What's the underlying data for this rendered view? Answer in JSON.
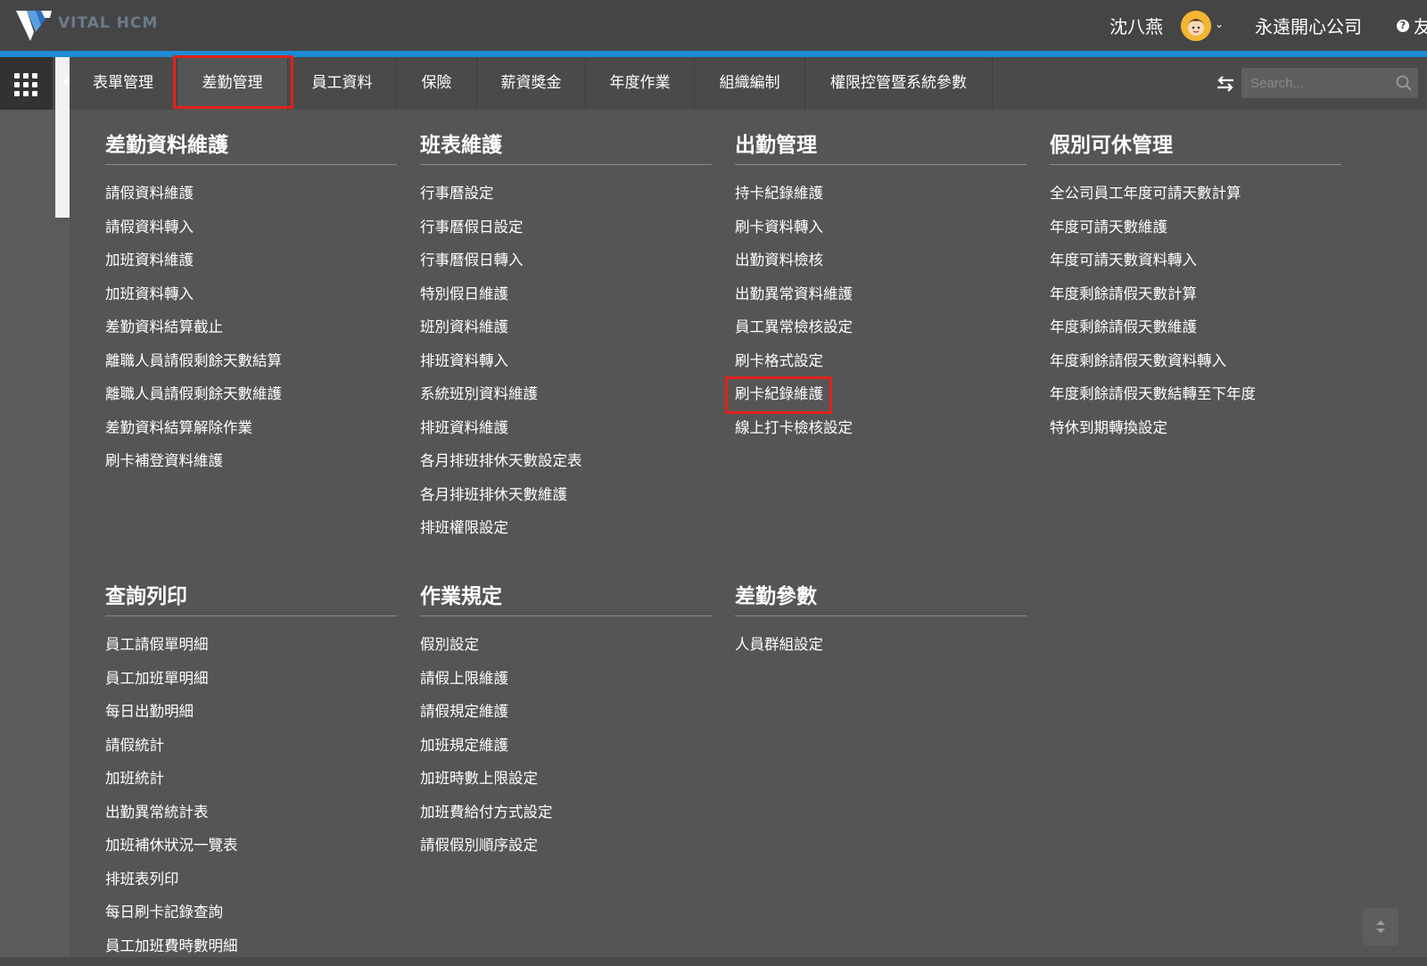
{
  "header": {
    "logo_text": "VITAL HCM",
    "user_name": "沈八燕",
    "company": "永遠開心公司",
    "help_text": "友",
    "colors": {
      "topbar": "#454545",
      "accent_line": "#1d8bd3",
      "highlight": "#e0221a"
    }
  },
  "nav": {
    "tabs": [
      {
        "label": "表單管理"
      },
      {
        "label": "差勤管理"
      },
      {
        "label": "員工資料"
      },
      {
        "label": "保險"
      },
      {
        "label": "薪資獎金"
      },
      {
        "label": "年度作業"
      },
      {
        "label": "組織編制"
      },
      {
        "label": "權限控管暨系統參數"
      }
    ],
    "active_tab": "差勤管理",
    "search_placeholder": "Search..."
  },
  "menu": {
    "sections": [
      {
        "title": "差勤資料維護",
        "items": [
          "請假資料維護",
          "請假資料轉入",
          "加班資料維護",
          "加班資料轉入",
          "差勤資料結算截止",
          "離職人員請假剩餘天數結算",
          "離職人員請假剩餘天數維護",
          "差勤資料結算解除作業",
          "刷卡補登資料維護"
        ]
      },
      {
        "title": "班表維護",
        "items": [
          "行事曆設定",
          "行事曆假日設定",
          "行事曆假日轉入",
          "特別假日維護",
          "班別資料維護",
          "排班資料轉入",
          "系統班別資料維護",
          "排班資料維護",
          "各月排班排休天數設定表",
          "各月排班排休天數維護",
          "排班權限設定"
        ]
      },
      {
        "title": "出勤管理",
        "items": [
          "持卡紀錄維護",
          "刷卡資料轉入",
          "出勤資料檢核",
          "出勤異常資料維護",
          "員工異常檢核設定",
          "刷卡格式設定",
          "刷卡紀錄維護",
          "線上打卡檢核設定"
        ]
      },
      {
        "title": "假別可休管理",
        "items": [
          "全公司員工年度可請天數計算",
          "年度可請天數維護",
          "年度可請天數資料轉入",
          "年度剩餘請假天數計算",
          "年度剩餘請假天數維護",
          "年度剩餘請假天數資料轉入",
          "年度剩餘請假天數結轉至下年度",
          "特休到期轉換設定"
        ]
      },
      {
        "title": "查詢列印",
        "items": [
          "員工請假單明細",
          "員工加班單明細",
          "每日出勤明細",
          "請假統計",
          "加班統計",
          "出勤異常統計表",
          "加班補休狀況一覽表",
          "排班表列印",
          "每日刷卡記錄查詢",
          "員工加班費時數明細"
        ]
      },
      {
        "title": "作業規定",
        "items": [
          "假別設定",
          "請假上限維護",
          "請假規定維護",
          "加班規定維護",
          "加班時數上限設定",
          "加班費給付方式設定",
          "請假假別順序設定"
        ]
      },
      {
        "title": "差勤參數",
        "items": [
          "人員群組設定"
        ]
      }
    ],
    "highlighted_item": "刷卡紀錄維護"
  }
}
